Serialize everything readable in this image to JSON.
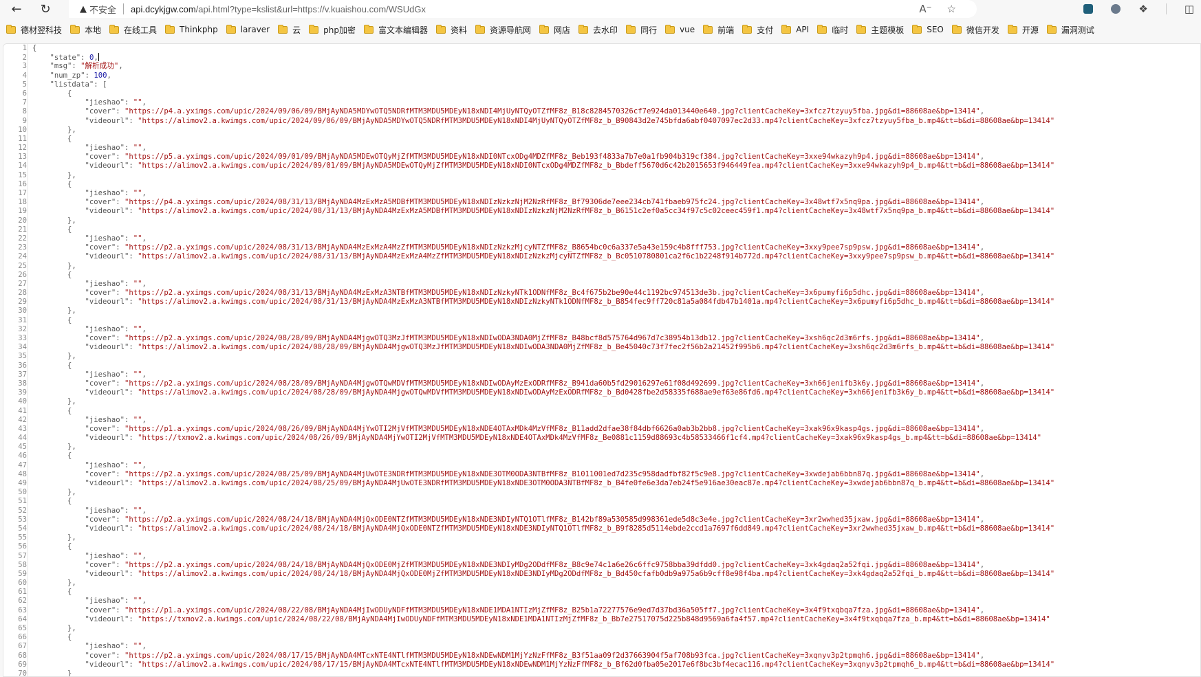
{
  "browser": {
    "back_icon": "back-arrow-icon",
    "reload_icon": "reload-icon",
    "security_label": "不安全",
    "url_host": "api.dcykjgw.com",
    "url_path": "/api.html?type=kslist&url=https://v.kuaishou.com/WSUdGx",
    "read_aloud_icon": "read-aloud-icon",
    "favorite_icon": "star-icon",
    "extensions_icon": "puzzle-icon",
    "split_icon": "split-screen-icon"
  },
  "bookmarks": [
    "德材翌科技",
    "本地",
    "在线工具",
    "Thinkphp",
    "laraver",
    "云",
    "php加密",
    "富文本编辑器",
    "资料",
    "资源导航网",
    "网店",
    "去水印",
    "同行",
    "vue",
    "前端",
    "支付",
    "API",
    "临时",
    "主题模板",
    "SEO",
    "微信开发",
    "开源",
    "漏洞测试"
  ],
  "json": {
    "state": "0",
    "msg": "解析成功",
    "num_zp": "100",
    "listdata": [
      {
        "jieshao": "",
        "cover": "https://p4.a.yximgs.com/upic/2024/09/06/09/BMjAyNDA5MDYwOTQ5NDRfMTM3MDU5MDEyN18xNDI4MjUyNTQyOTZfMF8z_B18c8284570326cf7e924da013440e640.jpg?clientCacheKey=3xfcz7tzyuy5fba.jpg&di=88608ae&bp=13414",
        "videourl": "https://alimov2.a.kwimgs.com/upic/2024/09/06/09/BMjAyNDA5MDYwOTQ5NDRfMTM3MDU5MDEyN18xNDI4MjUyNTQyOTZfMF8z_b_B90843d2e745bfda6abf0407097ec2d33.mp4?clientCacheKey=3xfcz7tzyuy5fba_b.mp4&tt=b&di=88608ae&bp=13414"
      },
      {
        "jieshao": "",
        "cover": "https://p5.a.yximgs.com/upic/2024/09/01/09/BMjAyNDA5MDEwOTQyMjZfMTM3MDU5MDEyN18xNDI0NTcxODg4MDZfMF8z_Beb193f4833a7b7e0a1fb904b319cf384.jpg?clientCacheKey=3xxe94wkazyh9p4.jpg&di=88608ae&bp=13414",
        "videourl": "https://alimov2.a.kwimgs.com/upic/2024/09/01/09/BMjAyNDA5MDEwOTQyMjZfMTM3MDU5MDEyN18xNDI0NTcxODg4MDZfMF8z_b_Bbdeff5670d6c42b2015653f946449fea.mp4?clientCacheKey=3xxe94wkazyh9p4_b.mp4&tt=b&di=88608ae&bp=13414"
      },
      {
        "jieshao": "",
        "cover": "https://p4.a.yximgs.com/upic/2024/08/31/13/BMjAyNDA4MzExMzA5MDBfMTM3MDU5MDEyN18xNDIzNzkzNjM2NzRfMF8z_Bf79306de7eee234cb741fbaeb975fc24.jpg?clientCacheKey=3x48wtf7x5nq9pa.jpg&di=88608ae&bp=13414",
        "videourl": "https://alimov2.a.kwimgs.com/upic/2024/08/31/13/BMjAyNDA4MzExMzA5MDBfMTM3MDU5MDEyN18xNDIzNzkzNjM2NzRfMF8z_b_B6151c2ef0a5cc34f97c5c02ceec459f1.mp4?clientCacheKey=3x48wtf7x5nq9pa_b.mp4&tt=b&di=88608ae&bp=13414"
      },
      {
        "jieshao": "",
        "cover": "https://p2.a.yximgs.com/upic/2024/08/31/13/BMjAyNDA4MzExMzA4MzZfMTM3MDU5MDEyN18xNDIzNzkzMjcyNTZfMF8z_B8654bc0c6a337e5a43e159c4b8fff753.jpg?clientCacheKey=3xxy9pee7sp9psw.jpg&di=88608ae&bp=13414",
        "videourl": "https://alimov2.a.kwimgs.com/upic/2024/08/31/13/BMjAyNDA4MzExMzA4MzZfMTM3MDU5MDEyN18xNDIzNzkzMjcyNTZfMF8z_b_Bc0510780801ca2f6c1b2248f914b772d.mp4?clientCacheKey=3xxy9pee7sp9psw_b.mp4&tt=b&di=88608ae&bp=13414"
      },
      {
        "jieshao": "",
        "cover": "https://p2.a.yximgs.com/upic/2024/08/31/13/BMjAyNDA4MzExMzA3NTBfMTM3MDU5MDEyN18xNDIzNzkyNTk1ODNfMF8z_Bc4f675b2be90e44c1192bc974513de3b.jpg?clientCacheKey=3x6pumyfi6p5dhc.jpg&di=88608ae&bp=13414",
        "videourl": "https://alimov2.a.kwimgs.com/upic/2024/08/31/13/BMjAyNDA4MzExMzA3NTBfMTM3MDU5MDEyN18xNDIzNzkyNTk1ODNfMF8z_b_B854fec9ff720c81a5a084fdb47b1401a.mp4?clientCacheKey=3x6pumyfi6p5dhc_b.mp4&tt=b&di=88608ae&bp=13414"
      },
      {
        "jieshao": "",
        "cover": "https://p2.a.yximgs.com/upic/2024/08/28/09/BMjAyNDA4MjgwOTQ3MzJfMTM3MDU5MDEyN18xNDIwODA3NDA0MjZfMF8z_B48bcf8d575764d967d7c38954b13db12.jpg?clientCacheKey=3xsh6qc2d3m6rfs.jpg&di=88608ae&bp=13414",
        "videourl": "https://alimov2.a.kwimgs.com/upic/2024/08/28/09/BMjAyNDA4MjgwOTQ3MzJfMTM3MDU5MDEyN18xNDIwODA3NDA0MjZfMF8z_b_Be45040c73f7fec2f56b2a21452f995b6.mp4?clientCacheKey=3xsh6qc2d3m6rfs_b.mp4&tt=b&di=88608ae&bp=13414"
      },
      {
        "jieshao": "",
        "cover": "https://p2.a.yximgs.com/upic/2024/08/28/09/BMjAyNDA4MjgwOTQwMDVfMTM3MDU5MDEyN18xNDIwODAyMzExODRfMF8z_B941da60b5fd29016297e61f08d492699.jpg?clientCacheKey=3xh66jenifb3k6y.jpg&di=88608ae&bp=13414",
        "videourl": "https://alimov2.a.kwimgs.com/upic/2024/08/28/09/BMjAyNDA4MjgwOTQwMDVfMTM3MDU5MDEyN18xNDIwODAyMzExODRfMF8z_b_Bd0428fbe2d58335f688ae9ef63e86fd6.mp4?clientCacheKey=3xh66jenifb3k6y_b.mp4&tt=b&di=88608ae&bp=13414"
      },
      {
        "jieshao": "",
        "cover": "https://p1.a.yximgs.com/upic/2024/08/26/09/BMjAyNDA4MjYwOTI2MjVfMTM3MDU5MDEyN18xNDE4OTAxMDk4MzVfMF8z_B11add2dfae38f84dbf6626a0ab3b2bb8.jpg?clientCacheKey=3xak96x9kasp4gs.jpg&di=88608ae&bp=13414",
        "videourl": "https://txmov2.a.kwimgs.com/upic/2024/08/26/09/BMjAyNDA4MjYwOTI2MjVfMTM3MDU5MDEyN18xNDE4OTAxMDk4MzVfMF8z_Be0881c1159d88693c4b58533466f1cf4.mp4?clientCacheKey=3xak96x9kasp4gs_b.mp4&tt=b&di=88608ae&bp=13414"
      },
      {
        "jieshao": "",
        "cover": "https://p2.a.yximgs.com/upic/2024/08/25/09/BMjAyNDA4MjUwOTE3NDRfMTM3MDU5MDEyN18xNDE3OTM0ODA3NTBfMF8z_B1011001ed7d235c958dadfbf82f5c9e8.jpg?clientCacheKey=3xwdejab6bbn87q.jpg&di=88608ae&bp=13414",
        "videourl": "https://alimov2.a.kwimgs.com/upic/2024/08/25/09/BMjAyNDA4MjUwOTE3NDRfMTM3MDU5MDEyN18xNDE3OTM0ODA3NTBfMF8z_b_B4fe0fe6e3da7eb24f5e916ae30eac87e.mp4?clientCacheKey=3xwdejab6bbn87q_b.mp4&tt=b&di=88608ae&bp=13414"
      },
      {
        "jieshao": "",
        "cover": "https://p2.a.yximgs.com/upic/2024/08/24/18/BMjAyNDA4MjQxODE0NTZfMTM3MDU5MDEyN18xNDE3NDIyNTQ1OTlfMF8z_B142bf89a530585d998361ede5d8c3e4e.jpg?clientCacheKey=3xr2wwhed35jxaw.jpg&di=88608ae&bp=13414",
        "videourl": "https://alimov2.a.kwimgs.com/upic/2024/08/24/18/BMjAyNDA4MjQxODE0NTZfMTM3MDU5MDEyN18xNDE3NDIyNTQ1OTlfMF8z_b_B9f8285d5114ebde2ccd1a7697f6dd849.mp4?clientCacheKey=3xr2wwhed35jxaw_b.mp4&tt=b&di=88608ae&bp=13414"
      },
      {
        "jieshao": "",
        "cover": "https://p2.a.yximgs.com/upic/2024/08/24/18/BMjAyNDA4MjQxODE0MjZfMTM3MDU5MDEyN18xNDE3NDIyMDg2ODdfMF8z_B8c9e74c1a6e26c6ffc9758bba39dfdd0.jpg?clientCacheKey=3xk4gdaq2a52fqi.jpg&di=88608ae&bp=13414",
        "videourl": "https://alimov2.a.kwimgs.com/upic/2024/08/24/18/BMjAyNDA4MjQxODE0MjZfMTM3MDU5MDEyN18xNDE3NDIyMDg2ODdfMF8z_b_Bd450cfafb0db9a975a6b9cff8e98f4ba.mp4?clientCacheKey=3xk4gdaq2a52fqi_b.mp4&tt=b&di=88608ae&bp=13414"
      },
      {
        "jieshao": "",
        "cover": "https://p1.a.yximgs.com/upic/2024/08/22/08/BMjAyNDA4MjIwODUyNDFfMTM3MDU5MDEyN18xNDE1MDA1NTIzMjZfMF8z_B25b1a72277576e9ed7d37bd36a505ff7.jpg?clientCacheKey=3x4f9txqbqa7fza.jpg&di=88608ae&bp=13414",
        "videourl": "https://txmov2.a.kwimgs.com/upic/2024/08/22/08/BMjAyNDA4MjIwODUyNDFfMTM3MDU5MDEyN18xNDE1MDA1NTIzMjZfMF8z_b_Bb7e27517075d225b848d9569a6fa4f57.mp4?clientCacheKey=3x4f9txqbqa7fza_b.mp4&tt=b&di=88608ae&bp=13414"
      },
      {
        "jieshao": "",
        "cover": "https://p2.a.yximgs.com/upic/2024/08/17/15/BMjAyNDA4MTcxNTE4NTlfMTM3MDU5MDEyN18xNDEwNDM1MjYzNzFfMF8z_B3f51aa09f2d37663904f5af708b93fca.jpg?clientCacheKey=3xqnyv3p2tpmqh6.jpg&di=88608ae&bp=13414",
        "videourl": "https://alimov2.a.kwimgs.com/upic/2024/08/17/15/BMjAyNDA4MTcxNTE4NTlfMTM3MDU5MDEyN18xNDEwNDM1MjYzNzFfMF8z_b_Bf62d0fba05e2017e6f8bc3bf4ecac116.mp4?clientCacheKey=3xqnyv3p2tpmqh6_b.mp4&tt=b&di=88608ae&bp=13414"
      }
    ]
  }
}
